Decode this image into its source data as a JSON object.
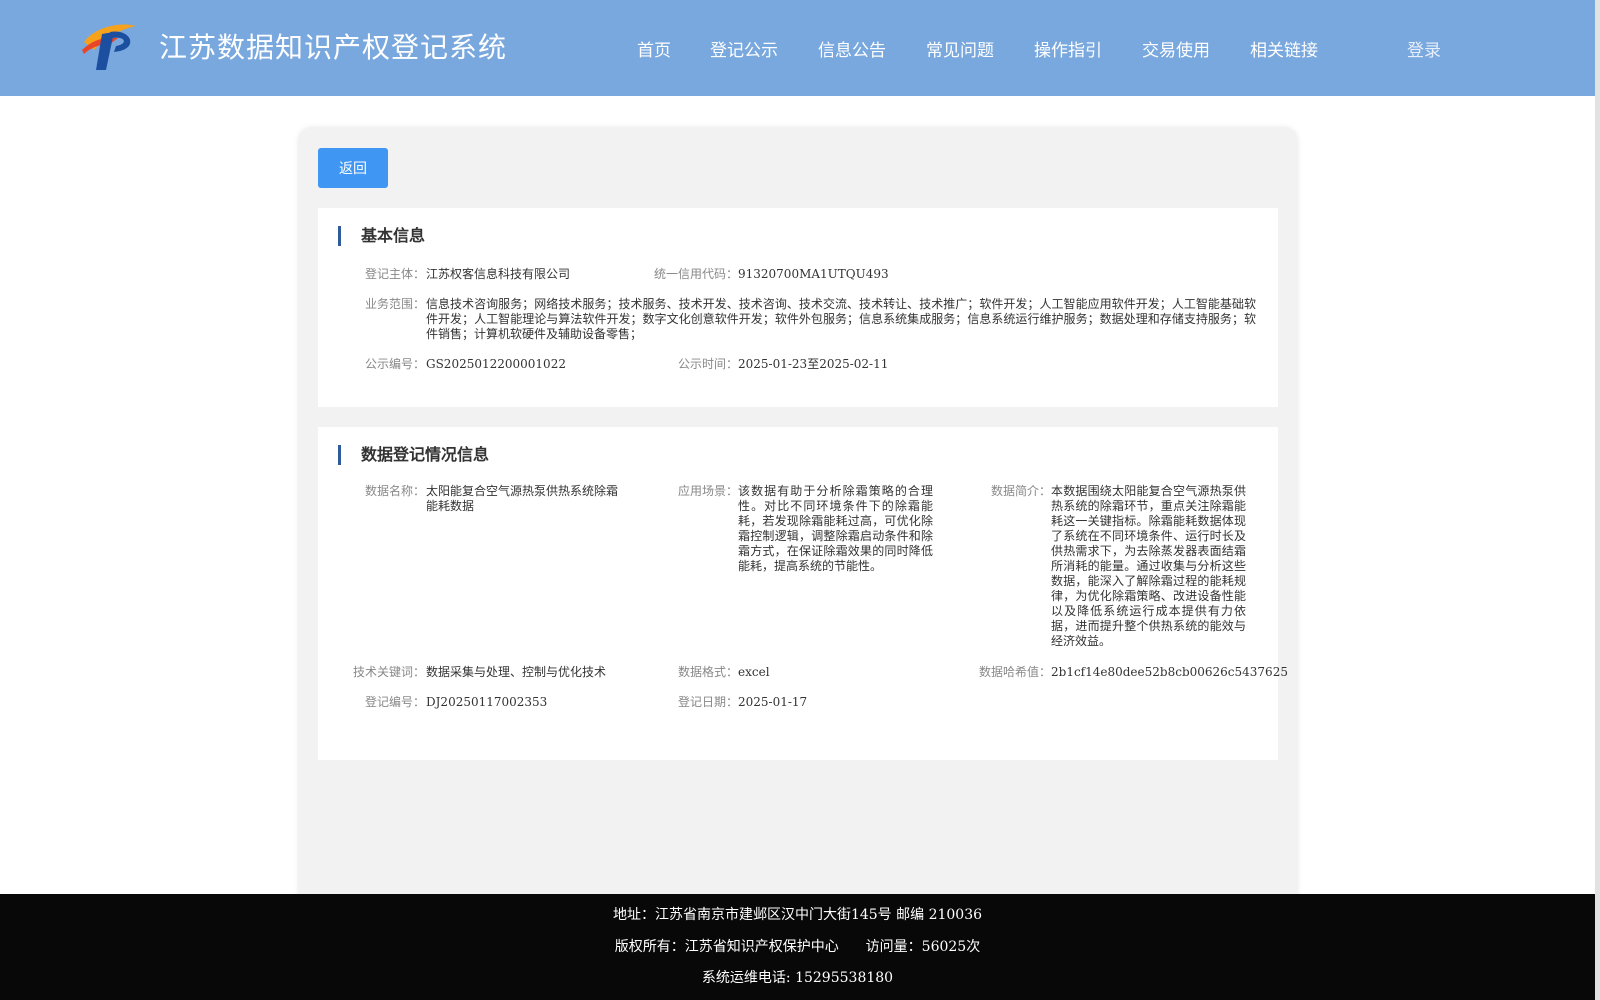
{
  "header": {
    "title": "江苏数据知识产权登记系统",
    "nav": [
      "首页",
      "登记公示",
      "信息公告",
      "常见问题",
      "操作指引",
      "交易使用",
      "相关链接"
    ],
    "login": "登录"
  },
  "main": {
    "back_label": "返回",
    "basic": {
      "title": "基本信息",
      "subject_label": "登记主体：",
      "subject": "江苏权客信息科技有限公司",
      "credit_label": "统一信用代码：",
      "credit": "91320700MA1UTQU493",
      "scope_label": "业务范围：",
      "scope": "信息技术咨询服务；网络技术服务；技术服务、技术开发、技术咨询、技术交流、技术转让、技术推广；软件开发；人工智能应用软件开发；人工智能基础软件开发；人工智能理论与算法软件开发；数字文化创意软件开发；软件外包服务；信息系统集成服务；信息系统运行维护服务；数据处理和存储支持服务；软件销售；计算机软硬件及辅助设备零售；",
      "notice_no_label": "公示编号：",
      "notice_no": "GS2025012200001022",
      "notice_time_label": "公示时间：",
      "notice_time": "2025-01-23至2025-02-11"
    },
    "registration": {
      "title": "数据登记情况信息",
      "name_label": "数据名称：",
      "name": "太阳能复合空气源热泵供热系统除霜能耗数据",
      "scene_label": "应用场景：",
      "scene": "该数据有助于分析除霜策略的合理性。对比不同环境条件下的除霜能耗，若发现除霜能耗过高，可优化除霜控制逻辑，调整除霜启动条件和除霜方式，在保证除霜效果的同时降低能耗，提高系统的节能性。",
      "intro_label": "数据简介：",
      "intro": "本数据围绕太阳能复合空气源热泵供热系统的除霜环节，重点关注除霜能耗这一关键指标。除霜能耗数据体现了系统在不同环境条件、运行时长及供热需求下，为去除蒸发器表面结霜所消耗的能量。通过收集与分析这些数据，能深入了解除霜过程的能耗规律，为优化除霜策略、改进设备性能以及降低系统运行成本提供有力依据，进而提升整个供热系统的能效与经济效益。",
      "keywords_label": "技术关键词：",
      "keywords": "数据采集与处理、控制与优化技术",
      "format_label": "数据格式：",
      "format": "excel",
      "hash_label": "数据哈希值：",
      "hash": "2b1cf14e80dee52b8cb00626c5437625",
      "reg_no_label": "登记编号：",
      "reg_no": "DJ20250117002353",
      "reg_date_label": "登记日期：",
      "reg_date": "2025-01-17"
    }
  },
  "footer": {
    "address": "地址：江苏省南京市建邺区汉中门大街145号 邮编 210036",
    "copyright": "版权所有：江苏省知识产权保护中心",
    "visits": "访问量：56025次",
    "phone": "系统运维电话: 15295538180"
  },
  "colors": {
    "header_bg": "#79a8de",
    "button": "#3f96f3",
    "title_bar": "#2e5b9a",
    "footer_bg": "#080808"
  }
}
